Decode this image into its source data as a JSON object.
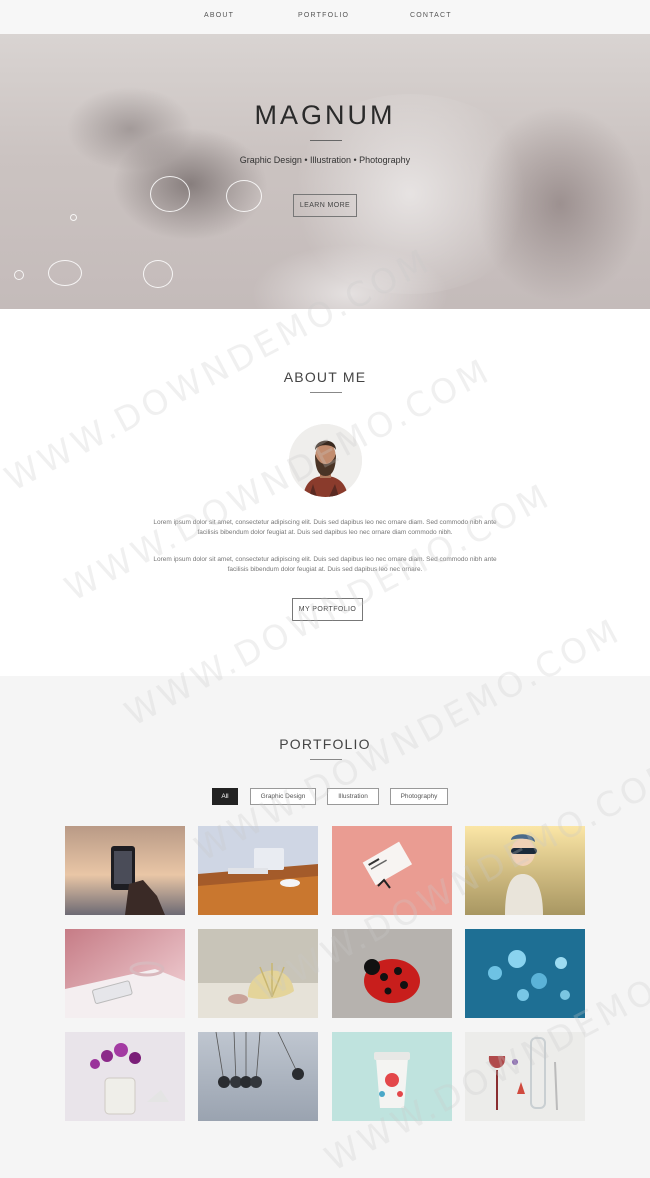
{
  "nav": {
    "items": [
      "ABOUT",
      "PORTFOLIO",
      "CONTACT"
    ]
  },
  "hero": {
    "title": "MAGNUM",
    "subtitle": "Graphic Design • Illustration • Photography",
    "button": "LEARN MORE"
  },
  "about": {
    "title": "ABOUT ME",
    "paragraph1": "Lorem ipsum dolor sit amet, consectetur adipiscing elit. Duis sed dapibus leo nec ornare diam. Sed commodo nibh ante facilisis bibendum dolor feugiat at. Duis sed dapibus leo nec ornare diam commodo nibh.",
    "paragraph2": "Lorem ipsum dolor sit amet, consectetur adipiscing elit. Duis sed dapibus leo nec ornare diam. Sed commodo nibh ante facilisis bibendum dolor feugiat at. Duis sed dapibus leo nec ornare.",
    "button": "MY PORTFOLIO"
  },
  "portfolio": {
    "title": "PORTFOLIO",
    "filters": [
      "All",
      "Graphic Design",
      "Illustration",
      "Photography"
    ],
    "active_filter": "All"
  },
  "watermark": "WWW.DOWNDEMO.COM"
}
